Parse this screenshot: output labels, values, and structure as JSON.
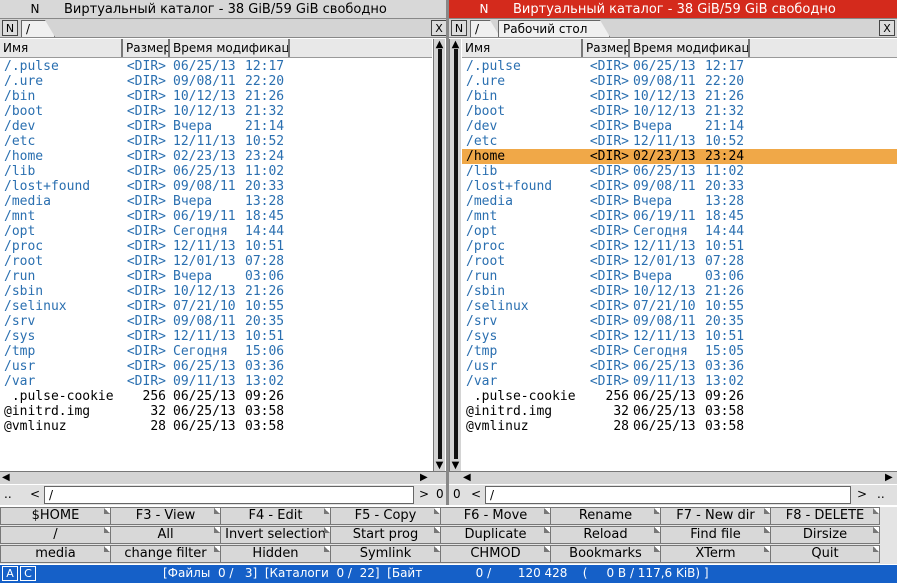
{
  "colors": {
    "active_title": "#d42a1c",
    "inactive_title": "#d8d8d8",
    "dir_text": "#2a6fb0",
    "selection": "#f0a848",
    "status_bg": "#1560c8"
  },
  "left_panel": {
    "title_n": "N",
    "title": "Виртуальный каталог - 38 GiB/59 GiB свободно",
    "tab_n": "N",
    "tab": "/",
    "close": "X",
    "col_name": "Имя",
    "col_size": "Размер",
    "col_time": "Время  модификации",
    "path_dots": "..",
    "path_left": "<",
    "path": "/",
    "path_right": ">",
    "path_zero": "0",
    "rows": [
      {
        "name": "/.pulse",
        "size": "<DIR>",
        "date": "06/25/13",
        "time": "12:17",
        "dir": true
      },
      {
        "name": "/.ure",
        "size": "<DIR>",
        "date": "09/08/11",
        "time": "22:20",
        "dir": true
      },
      {
        "name": "/bin",
        "size": "<DIR>",
        "date": "10/12/13",
        "time": "21:26",
        "dir": true
      },
      {
        "name": "/boot",
        "size": "<DIR>",
        "date": "10/12/13",
        "time": "21:32",
        "dir": true
      },
      {
        "name": "/dev",
        "size": "<DIR>",
        "date": "Вчера",
        "time": "21:14",
        "dir": true
      },
      {
        "name": "/etc",
        "size": "<DIR>",
        "date": "12/11/13",
        "time": "10:52",
        "dir": true
      },
      {
        "name": "/home",
        "size": "<DIR>",
        "date": "02/23/13",
        "time": "23:24",
        "dir": true
      },
      {
        "name": "/lib",
        "size": "<DIR>",
        "date": "06/25/13",
        "time": "11:02",
        "dir": true
      },
      {
        "name": "/lost+found",
        "size": "<DIR>",
        "date": "09/08/11",
        "time": "20:33",
        "dir": true
      },
      {
        "name": "/media",
        "size": "<DIR>",
        "date": "Вчера",
        "time": "13:28",
        "dir": true
      },
      {
        "name": "/mnt",
        "size": "<DIR>",
        "date": "06/19/11",
        "time": "18:45",
        "dir": true
      },
      {
        "name": "/opt",
        "size": "<DIR>",
        "date": "Сегодня",
        "time": "14:44",
        "dir": true
      },
      {
        "name": "/proc",
        "size": "<DIR>",
        "date": "12/11/13",
        "time": "10:51",
        "dir": true
      },
      {
        "name": "/root",
        "size": "<DIR>",
        "date": "12/01/13",
        "time": "07:28",
        "dir": true
      },
      {
        "name": "/run",
        "size": "<DIR>",
        "date": "Вчера",
        "time": "03:06",
        "dir": true
      },
      {
        "name": "/sbin",
        "size": "<DIR>",
        "date": "10/12/13",
        "time": "21:26",
        "dir": true
      },
      {
        "name": "/selinux",
        "size": "<DIR>",
        "date": "07/21/10",
        "time": "10:55",
        "dir": true
      },
      {
        "name": "/srv",
        "size": "<DIR>",
        "date": "09/08/11",
        "time": "20:35",
        "dir": true
      },
      {
        "name": "/sys",
        "size": "<DIR>",
        "date": "12/11/13",
        "time": "10:51",
        "dir": true
      },
      {
        "name": "/tmp",
        "size": "<DIR>",
        "date": "Сегодня",
        "time": "15:06",
        "dir": true
      },
      {
        "name": "/usr",
        "size": "<DIR>",
        "date": "06/25/13",
        "time": "03:36",
        "dir": true
      },
      {
        "name": "/var",
        "size": "<DIR>",
        "date": "09/11/13",
        "time": "13:02",
        "dir": true
      },
      {
        "name": " .pulse-cookie",
        "size": "256",
        "date": "06/25/13",
        "time": "09:26",
        "dir": false
      },
      {
        "name": "@initrd.img",
        "size": "32",
        "date": "06/25/13",
        "time": "03:58",
        "dir": false
      },
      {
        "name": "@vmlinuz",
        "size": "28",
        "date": "06/25/13",
        "time": "03:58",
        "dir": false
      }
    ]
  },
  "right_panel": {
    "title_n": "N",
    "title": "Виртуальный каталог - 38 GiB/59 GiB свободно",
    "tab_n": "N",
    "tab1": "/",
    "tab2": "Рабочий  стол",
    "close": "X",
    "col_name": "Имя",
    "col_size": "Размер",
    "col_time": "Время  модификации",
    "path_zero": "0",
    "path_left": "<",
    "path": "/",
    "path_right": ">",
    "path_dots": "..",
    "selected_index": 6,
    "rows": [
      {
        "name": "/.pulse",
        "size": "<DIR>",
        "date": "06/25/13",
        "time": "12:17",
        "dir": true
      },
      {
        "name": "/.ure",
        "size": "<DIR>",
        "date": "09/08/11",
        "time": "22:20",
        "dir": true
      },
      {
        "name": "/bin",
        "size": "<DIR>",
        "date": "10/12/13",
        "time": "21:26",
        "dir": true
      },
      {
        "name": "/boot",
        "size": "<DIR>",
        "date": "10/12/13",
        "time": "21:32",
        "dir": true
      },
      {
        "name": "/dev",
        "size": "<DIR>",
        "date": "Вчера",
        "time": "21:14",
        "dir": true
      },
      {
        "name": "/etc",
        "size": "<DIR>",
        "date": "12/11/13",
        "time": "10:52",
        "dir": true
      },
      {
        "name": "/home",
        "size": "<DIR>",
        "date": "02/23/13",
        "time": "23:24",
        "dir": true
      },
      {
        "name": "/lib",
        "size": "<DIR>",
        "date": "06/25/13",
        "time": "11:02",
        "dir": true
      },
      {
        "name": "/lost+found",
        "size": "<DIR>",
        "date": "09/08/11",
        "time": "20:33",
        "dir": true
      },
      {
        "name": "/media",
        "size": "<DIR>",
        "date": "Вчера",
        "time": "13:28",
        "dir": true
      },
      {
        "name": "/mnt",
        "size": "<DIR>",
        "date": "06/19/11",
        "time": "18:45",
        "dir": true
      },
      {
        "name": "/opt",
        "size": "<DIR>",
        "date": "Сегодня",
        "time": "14:44",
        "dir": true
      },
      {
        "name": "/proc",
        "size": "<DIR>",
        "date": "12/11/13",
        "time": "10:51",
        "dir": true
      },
      {
        "name": "/root",
        "size": "<DIR>",
        "date": "12/01/13",
        "time": "07:28",
        "dir": true
      },
      {
        "name": "/run",
        "size": "<DIR>",
        "date": "Вчера",
        "time": "03:06",
        "dir": true
      },
      {
        "name": "/sbin",
        "size": "<DIR>",
        "date": "10/12/13",
        "time": "21:26",
        "dir": true
      },
      {
        "name": "/selinux",
        "size": "<DIR>",
        "date": "07/21/10",
        "time": "10:55",
        "dir": true
      },
      {
        "name": "/srv",
        "size": "<DIR>",
        "date": "09/08/11",
        "time": "20:35",
        "dir": true
      },
      {
        "name": "/sys",
        "size": "<DIR>",
        "date": "12/11/13",
        "time": "10:51",
        "dir": true
      },
      {
        "name": "/tmp",
        "size": "<DIR>",
        "date": "Сегодня",
        "time": "15:05",
        "dir": true
      },
      {
        "name": "/usr",
        "size": "<DIR>",
        "date": "06/25/13",
        "time": "03:36",
        "dir": true
      },
      {
        "name": "/var",
        "size": "<DIR>",
        "date": "09/11/13",
        "time": "13:02",
        "dir": true
      },
      {
        "name": " .pulse-cookie",
        "size": "256",
        "date": "06/25/13",
        "time": "09:26",
        "dir": false
      },
      {
        "name": "@initrd.img",
        "size": "32",
        "date": "06/25/13",
        "time": "03:58",
        "dir": false
      },
      {
        "name": "@vmlinuz",
        "size": "28",
        "date": "06/25/13",
        "time": "03:58",
        "dir": false
      }
    ]
  },
  "function_buttons": [
    [
      "$HOME",
      "F3 - View",
      "F4 - Edit",
      "F5 - Copy",
      "F6 - Move",
      "Rename",
      "F7 - New dir",
      "F8 - DELETE"
    ],
    [
      "/",
      "All",
      "Invert selection",
      "Start prog",
      "Duplicate",
      "Reload",
      "Find file",
      "Dirsize"
    ],
    [
      "media",
      "change filter",
      "Hidden",
      "Symlink",
      "CHMOD",
      "Bookmarks",
      "XTerm",
      "Quit"
    ]
  ],
  "status": {
    "btn_a": "A",
    "btn_c": "C",
    "text": "[Файлы  0 /   3]  [Каталоги  0 /  22]  [Байт              0 /       120 428    (     0 В / 117,6 KiB) ]"
  }
}
